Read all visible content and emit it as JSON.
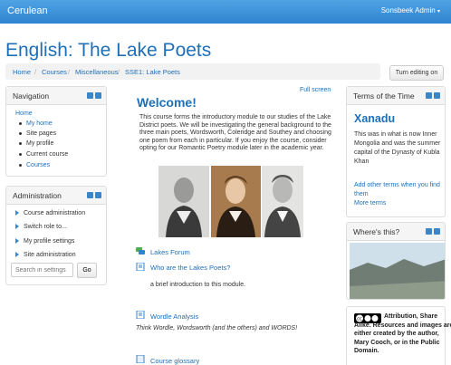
{
  "header": {
    "brand": "Cerulean",
    "user": "Sonsbeek Admin"
  },
  "page": {
    "title": "English: The Lake Poets"
  },
  "breadcrumb": [
    "Home",
    "Courses",
    "Miscellaneous",
    "SSE1: Lake Poets"
  ],
  "edit_button": "Turn editing on",
  "navigation": {
    "title": "Navigation",
    "items": [
      "Home",
      "My home",
      "Site pages",
      "My profile",
      "Current course",
      "Courses"
    ]
  },
  "administration": {
    "title": "Administration",
    "items": [
      "Course administration",
      "Switch role to...",
      "My profile settings",
      "Site administration"
    ],
    "search_placeholder": "Search in settings",
    "go_label": "Go"
  },
  "main": {
    "fullscreen": "Full screen",
    "welcome": "Welcome!",
    "intro": "This course forms the introductory module to our studies of the Lake District poets. We will be investigating the  general background to the three main poets, Wordsworth, Coleridge and Southey and choosing one poem from each in particular. If you enjoy the course, consider opting for our Romantic Poetry module later in the academic year.",
    "activities": [
      {
        "label": "Lakes Forum"
      },
      {
        "label": "Who are the Lakes Poets?",
        "description": "a brief introduction to this module."
      },
      {
        "label": "Wordle Analysis",
        "description": "Think Wordle, Wordsworth (and the others) and WORDS!"
      },
      {
        "label": "Course glossary"
      }
    ]
  },
  "terms_block": {
    "title": "Terms of the Time",
    "term": "Xanadu",
    "definition": "This was in what is now Inner Mongolia and was the summer capital of the Dynasty of Kubla Khan",
    "add_link": "Add other terms when you find them",
    "more_link": "More terms"
  },
  "where_block": {
    "title": "Where's this?"
  },
  "license_block": {
    "text": "Attribution, Share Alike. Resources and images are either created by the author, Mary Cooch, or in the Public Domain."
  },
  "colors": {
    "brand": "#2f84d0",
    "link": "#1f6fb8"
  },
  "icons": [
    "collapse-icon",
    "dock-icon",
    "caret-icon",
    "forum-icon",
    "page-icon",
    "glossary-icon",
    "cc-icon"
  ]
}
